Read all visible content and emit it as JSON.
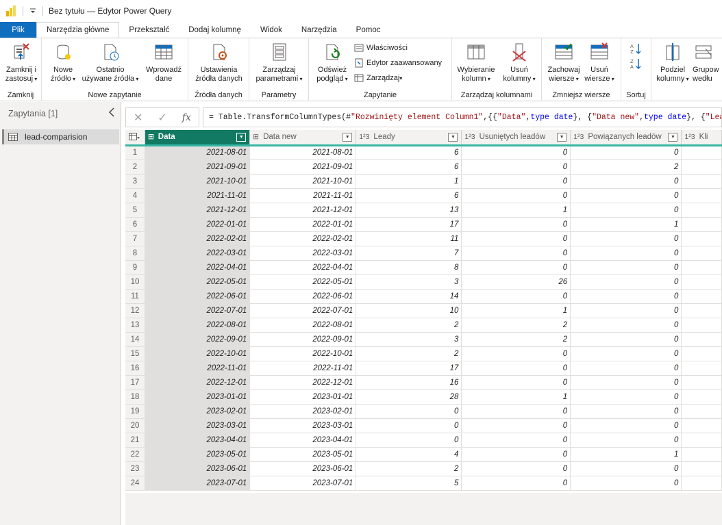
{
  "window": {
    "title": "Bez tytułu — Edytor Power Query",
    "qa_icon": "customize-quick-access-icon"
  },
  "tabs": [
    "Plik",
    "Narzędzia główne",
    "Przekształć",
    "Dodaj kolumnę",
    "Widok",
    "Narzędzia",
    "Pomoc"
  ],
  "ribbon": {
    "close_apply_l1": "Zamknij i",
    "close_apply_l2": "zastosuj",
    "group_close": "Zamknij",
    "new_source_l1": "Nowe",
    "new_source_l2": "źródło",
    "recent_sources_l1": "Ostatnio",
    "recent_sources_l2": "używane źródła",
    "enter_data_l1": "Wprowadź",
    "enter_data_l2": "dane",
    "group_new_query": "Nowe zapytanie",
    "ds_settings_l1": "Ustawienia",
    "ds_settings_l2": "źródła danych",
    "group_data_sources": "Źródła danych",
    "manage_params_l1": "Zarządzaj",
    "manage_params_l2": "parametrami",
    "group_parameters": "Parametry",
    "refresh_l1": "Odśwież",
    "refresh_l2": "podgląd",
    "properties": "Właściwości",
    "advanced_editor": "Edytor zaawansowany",
    "manage": "Zarządzaj",
    "group_query": "Zapytanie",
    "choose_cols_l1": "Wybieranie",
    "choose_cols_l2": "kolumn",
    "remove_cols_l1": "Usuń",
    "remove_cols_l2": "kolumny",
    "group_manage_cols": "Zarządzaj kolumnami",
    "keep_rows_l1": "Zachowaj",
    "keep_rows_l2": "wiersze",
    "remove_rows_l1": "Usuń",
    "remove_rows_l2": "wiersze",
    "group_reduce_rows": "Zmniejsz wiersze",
    "group_sort": "Sortuj",
    "split_col_l1": "Podziel",
    "split_col_l2": "kolumny",
    "group_by_l1": "Grupow",
    "group_by_l2": "wedłu"
  },
  "queries": {
    "header": "Zapytania [1]",
    "items": [
      "lead-comparision"
    ]
  },
  "formula": {
    "p1": "= Table.TransformColumnTypes(#",
    "p2": "\"Rozwinięty element Column1\"",
    "p3": ",{{",
    "p4": "\"Data\"",
    "p5": ", ",
    "p6": "type date",
    "p7": "}, {",
    "p8": "\"Data new\"",
    "p9": ", ",
    "p10": "type date",
    "p11": "}, {",
    "p12": "\"Leady\""
  },
  "columns": [
    {
      "type": "⊞",
      "name": "Data",
      "selected": true
    },
    {
      "type": "⊞",
      "name": "Data new",
      "selected": false
    },
    {
      "type": "1²3",
      "name": "Leady",
      "selected": false
    },
    {
      "type": "1²3",
      "name": "Usuniętych leadów",
      "selected": false
    },
    {
      "type": "1²3",
      "name": "Powiązanych leadów",
      "selected": false
    },
    {
      "type": "1²3",
      "name": "Kli",
      "selected": false
    }
  ],
  "rows": [
    [
      "2021-08-01",
      "2021-08-01",
      "6",
      "0",
      "0"
    ],
    [
      "2021-09-01",
      "2021-09-01",
      "6",
      "0",
      "2"
    ],
    [
      "2021-10-01",
      "2021-10-01",
      "1",
      "0",
      "0"
    ],
    [
      "2021-11-01",
      "2021-11-01",
      "6",
      "0",
      "0"
    ],
    [
      "2021-12-01",
      "2021-12-01",
      "13",
      "1",
      "0"
    ],
    [
      "2022-01-01",
      "2022-01-01",
      "17",
      "0",
      "1"
    ],
    [
      "2022-02-01",
      "2022-02-01",
      "11",
      "0",
      "0"
    ],
    [
      "2022-03-01",
      "2022-03-01",
      "7",
      "0",
      "0"
    ],
    [
      "2022-04-01",
      "2022-04-01",
      "8",
      "0",
      "0"
    ],
    [
      "2022-05-01",
      "2022-05-01",
      "3",
      "26",
      "0"
    ],
    [
      "2022-06-01",
      "2022-06-01",
      "14",
      "0",
      "0"
    ],
    [
      "2022-07-01",
      "2022-07-01",
      "10",
      "1",
      "0"
    ],
    [
      "2022-08-01",
      "2022-08-01",
      "2",
      "2",
      "0"
    ],
    [
      "2022-09-01",
      "2022-09-01",
      "3",
      "2",
      "0"
    ],
    [
      "2022-10-01",
      "2022-10-01",
      "2",
      "0",
      "0"
    ],
    [
      "2022-11-01",
      "2022-11-01",
      "17",
      "0",
      "0"
    ],
    [
      "2022-12-01",
      "2022-12-01",
      "16",
      "0",
      "0"
    ],
    [
      "2023-01-01",
      "2023-01-01",
      "28",
      "1",
      "0"
    ],
    [
      "2023-02-01",
      "2023-02-01",
      "0",
      "0",
      "0"
    ],
    [
      "2023-03-01",
      "2023-03-01",
      "0",
      "0",
      "0"
    ],
    [
      "2023-04-01",
      "2023-04-01",
      "0",
      "0",
      "0"
    ],
    [
      "2023-05-01",
      "2023-05-01",
      "4",
      "0",
      "1"
    ],
    [
      "2023-06-01",
      "2023-06-01",
      "2",
      "0",
      "0"
    ],
    [
      "2023-07-01",
      "2023-07-01",
      "5",
      "0",
      "0"
    ]
  ],
  "colors": {
    "accent": "#127a62",
    "file_tab": "#106ebe",
    "header_underline": "#33b5a1"
  }
}
